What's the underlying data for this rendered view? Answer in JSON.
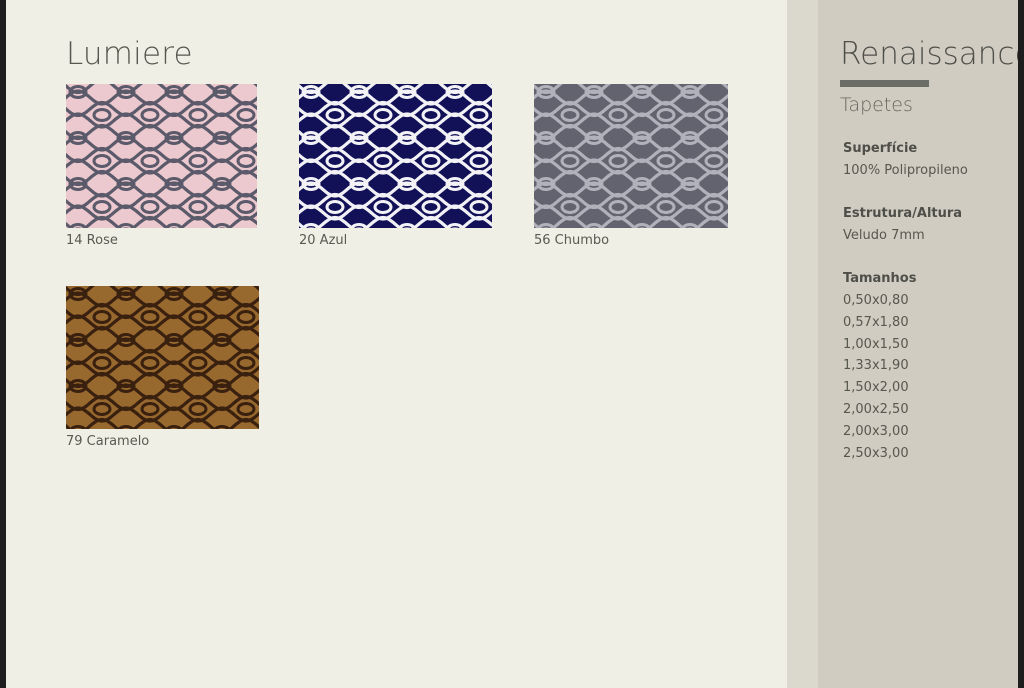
{
  "catalog": {
    "title": "Lumiere",
    "swatches": [
      {
        "label": "14 Rose",
        "colors": {
          "bg": "#ecc9cf",
          "line": "#5b5a6a"
        }
      },
      {
        "label": "20 Azul",
        "colors": {
          "bg": "#121158",
          "line": "#f1f1f6"
        }
      },
      {
        "label": "56 Chumbo",
        "colors": {
          "bg": "#62636e",
          "line": "#b1b1bc"
        }
      },
      {
        "label": "79 Caramelo",
        "colors": {
          "bg": "#98692f",
          "line": "#3a200f"
        }
      }
    ]
  },
  "sidebar": {
    "title": "Renaissance",
    "subtitle": "Tapetes",
    "specs": [
      {
        "label": "Superfície",
        "value": "100% Polipropileno"
      },
      {
        "label": "Estrutura/Altura",
        "value": "Veludo 7mm"
      }
    ],
    "sizes_label": "Tamanhos",
    "sizes": [
      "0,50x0,80",
      "0,57x1,80",
      "1,00x1,50",
      "1,33x1,90",
      "1,50x2,00",
      "2,00x2,50",
      "2,00x3,00",
      "2,50x3,00"
    ],
    "accent_bar_color": "#6d6d68"
  }
}
